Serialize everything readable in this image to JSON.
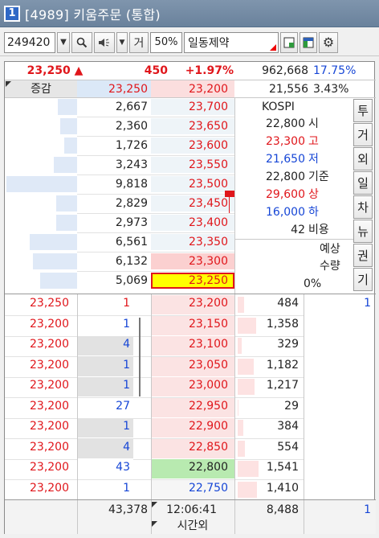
{
  "window": {
    "number": "1",
    "title": "[4989] 키움주문 (통합)"
  },
  "toolbar": {
    "code": "249420",
    "sub_label": "거",
    "percent": "50%",
    "stock_name": "일동제약"
  },
  "summary": {
    "price": "23,250",
    "arrow": "▲",
    "change": "450",
    "change_pct": "+1.97%",
    "volume": "962,668",
    "volume_ratio": "17.75%"
  },
  "header": {
    "label": "증감",
    "bid_price": "23,250",
    "ask_price": "23,200",
    "trade_qty": "21,556",
    "trade_pct": "3.43%"
  },
  "ask_rows": [
    {
      "qty": "2,667",
      "price": "23,700",
      "qty_frac": 0.27
    },
    {
      "qty": "2,360",
      "price": "23,650",
      "qty_frac": 0.24
    },
    {
      "qty": "1,726",
      "price": "23,600",
      "qty_frac": 0.18
    },
    {
      "qty": "3,243",
      "price": "23,550",
      "qty_frac": 0.33
    },
    {
      "qty": "9,818",
      "price": "23,500",
      "qty_frac": 1.0
    },
    {
      "qty": "2,829",
      "price": "23,450",
      "qty_frac": 0.29
    },
    {
      "qty": "2,973",
      "price": "23,400",
      "qty_frac": 0.3
    },
    {
      "qty": "6,561",
      "price": "23,350",
      "qty_frac": 0.67
    },
    {
      "qty": "6,132",
      "price": "23,300",
      "qty_frac": 0.62
    },
    {
      "qty": "5,069",
      "price": "23,250",
      "qty_frac": 0.52
    }
  ],
  "info": {
    "market": "KOSPI",
    "rows": [
      {
        "value": "22,800",
        "label": "시",
        "color": "blk"
      },
      {
        "value": "23,300",
        "label": "고",
        "color": "red"
      },
      {
        "value": "21,650",
        "label": "저",
        "color": "blue"
      },
      {
        "value": "22,800",
        "label": "기준",
        "color": "blk"
      },
      {
        "value": "29,600",
        "label": "상",
        "color": "red"
      },
      {
        "value": "16,000",
        "label": "하",
        "color": "blue"
      }
    ],
    "cost_value": "42",
    "cost_label": "비용",
    "expect_label": "예상",
    "expect_label2": "수량",
    "expect_pct": "0%"
  },
  "side_buttons": [
    "투",
    "거",
    "외",
    "일",
    "차",
    "뉴",
    "권",
    "기"
  ],
  "trades": [
    {
      "price": "23,250",
      "qty": "1",
      "qty_color": "red"
    },
    {
      "price": "23,200",
      "qty": "1",
      "qty_color": "blue"
    },
    {
      "price": "23,200",
      "qty": "4",
      "qty_color": "blue"
    },
    {
      "price": "23,200",
      "qty": "1",
      "qty_color": "blue"
    },
    {
      "price": "23,200",
      "qty": "1",
      "qty_color": "blue"
    },
    {
      "price": "23,200",
      "qty": "27",
      "qty_color": "blue"
    },
    {
      "price": "23,200",
      "qty": "1",
      "qty_color": "blue"
    },
    {
      "price": "23,200",
      "qty": "4",
      "qty_color": "blue"
    },
    {
      "price": "23,200",
      "qty": "43",
      "qty_color": "blue"
    },
    {
      "price": "23,200",
      "qty": "1",
      "qty_color": "blue"
    }
  ],
  "bid_rows": [
    {
      "price": "23,200",
      "qty": "484",
      "qty_frac": 0.31,
      "color": "red"
    },
    {
      "price": "23,150",
      "qty": "1,358",
      "qty_frac": 0.88,
      "color": "red"
    },
    {
      "price": "23,100",
      "qty": "329",
      "qty_frac": 0.21,
      "color": "red"
    },
    {
      "price": "23,050",
      "qty": "1,182",
      "qty_frac": 0.77,
      "color": "red"
    },
    {
      "price": "23,000",
      "qty": "1,217",
      "qty_frac": 0.79,
      "color": "red"
    },
    {
      "price": "22,950",
      "qty": "29",
      "qty_frac": 0.02,
      "color": "red"
    },
    {
      "price": "22,900",
      "qty": "384",
      "qty_frac": 0.25,
      "color": "red"
    },
    {
      "price": "22,850",
      "qty": "554",
      "qty_frac": 0.36,
      "color": "red"
    },
    {
      "price": "22,800",
      "qty": "1,541",
      "qty_frac": 1.0,
      "color": "blk"
    },
    {
      "price": "22,750",
      "qty": "1,410",
      "qty_frac": 0.91,
      "color": "blue"
    }
  ],
  "bid_side_value": "1",
  "footer": {
    "ask_total": "43,378",
    "time": "12:06:41",
    "bid_total": "8,488",
    "right": "1",
    "after_hours": "시간외"
  }
}
